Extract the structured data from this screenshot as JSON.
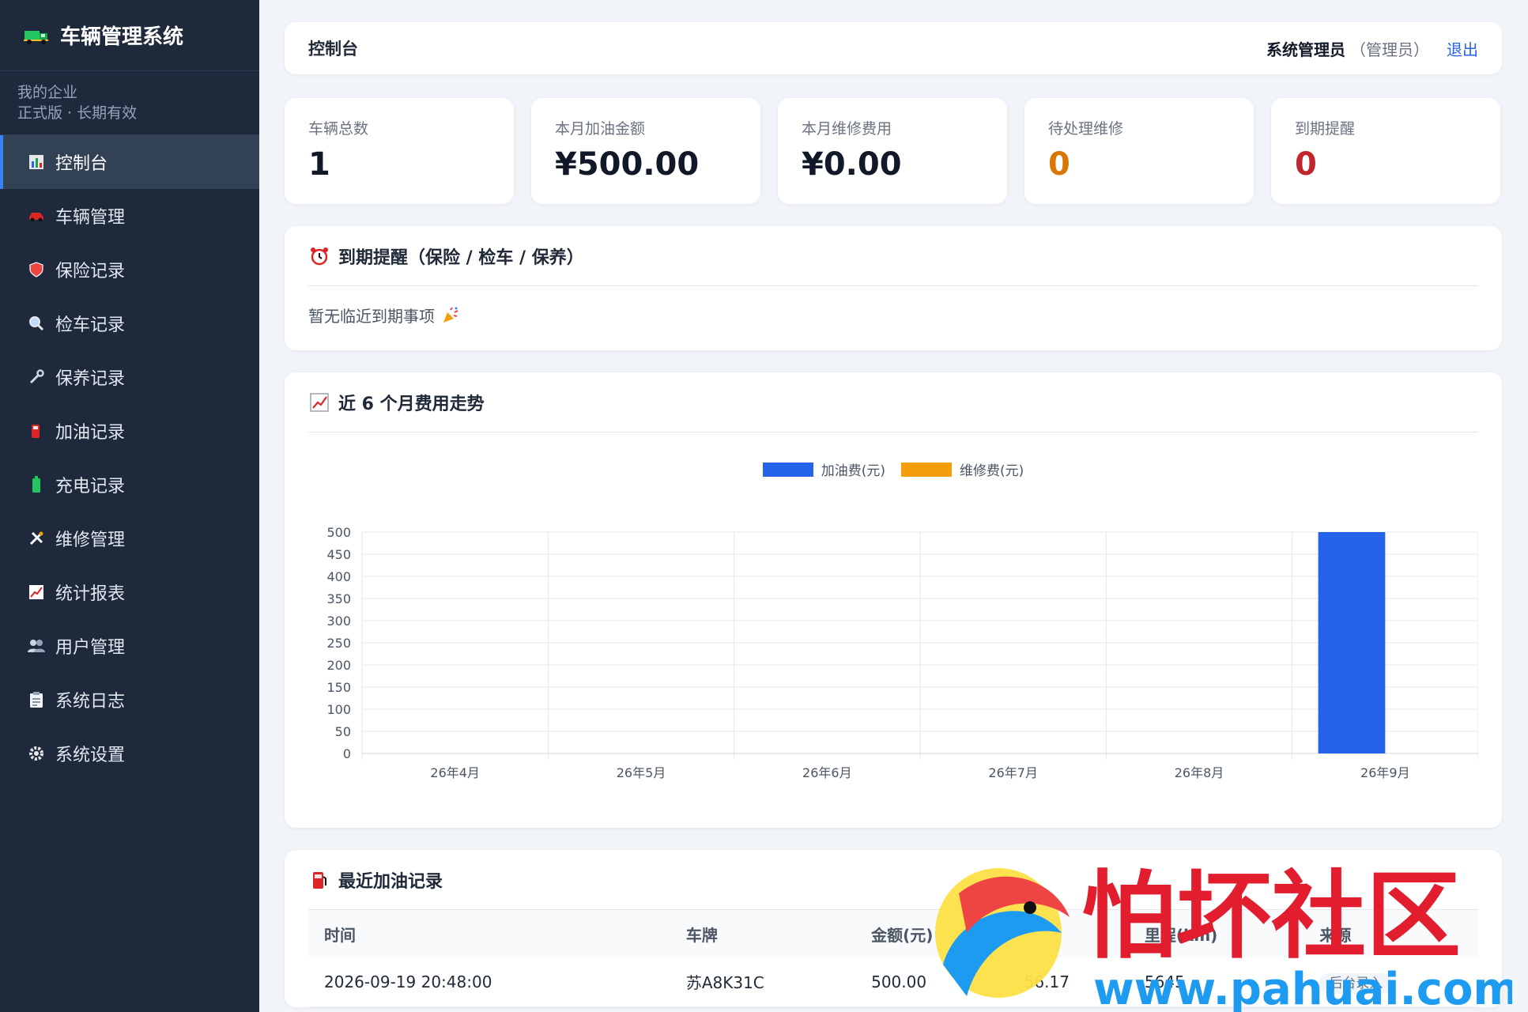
{
  "sidebar": {
    "brand": "车辆管理系统",
    "company_line1": "我的企业",
    "company_line2": "正式版 · 长期有效",
    "items": [
      {
        "label": "控制台",
        "icon": "bar-chart-icon",
        "active": true
      },
      {
        "label": "车辆管理",
        "icon": "car-icon"
      },
      {
        "label": "保险记录",
        "icon": "shield-icon"
      },
      {
        "label": "检车记录",
        "icon": "magnifier-icon"
      },
      {
        "label": "保养记录",
        "icon": "wrench-icon"
      },
      {
        "label": "加油记录",
        "icon": "fuel-pump-icon"
      },
      {
        "label": "充电记录",
        "icon": "battery-icon"
      },
      {
        "label": "维修管理",
        "icon": "tools-icon"
      },
      {
        "label": "统计报表",
        "icon": "trend-chart-icon"
      },
      {
        "label": "用户管理",
        "icon": "users-icon"
      },
      {
        "label": "系统日志",
        "icon": "clipboard-icon"
      },
      {
        "label": "系统设置",
        "icon": "gear-icon"
      }
    ]
  },
  "header": {
    "title": "控制台",
    "user_name": "系统管理员",
    "user_role": "（管理员）",
    "logout": "退出"
  },
  "stats": [
    {
      "label": "车辆总数",
      "value": "1",
      "color": "#111827"
    },
    {
      "label": "本月加油金额",
      "value": "¥500.00",
      "color": "#111827"
    },
    {
      "label": "本月维修费用",
      "value": "¥0.00",
      "color": "#111827"
    },
    {
      "label": "待处理维修",
      "value": "0",
      "color": "#d97706"
    },
    {
      "label": "到期提醒",
      "value": "0",
      "color": "#c0262d"
    }
  ],
  "reminders": {
    "title": "到期提醒（保险 / 检车 / 保养）",
    "empty_text": "暂无临近到期事项"
  },
  "trend": {
    "title": "近 6 个月费用走势"
  },
  "chart_data": {
    "type": "bar",
    "categories": [
      "26年4月",
      "26年5月",
      "26年6月",
      "26年7月",
      "26年8月",
      "26年9月"
    ],
    "series": [
      {
        "name": "加油费(元)",
        "values": [
          0,
          0,
          0,
          0,
          0,
          500
        ],
        "color": "#2563eb"
      },
      {
        "name": "维修费(元)",
        "values": [
          0,
          0,
          0,
          0,
          0,
          0
        ],
        "color": "#f59e0b"
      }
    ],
    "ylim": [
      0,
      500
    ],
    "yticks": [
      0,
      50,
      100,
      150,
      200,
      250,
      300,
      350,
      400,
      450,
      500
    ],
    "grid": true,
    "legend": "top-center"
  },
  "fuel": {
    "title": "最近加油记录",
    "columns": [
      "时间",
      "车牌",
      "金额(元)",
      "",
      "里程(km)",
      "来源"
    ],
    "rows": [
      {
        "time": "2026-09-19 20:48:00",
        "plate": "苏A8K31C",
        "amount": "500.00",
        "liters": "56.17",
        "mileage": "5645",
        "source": "后台录入"
      }
    ]
  },
  "watermark": {
    "text": "怕坏社区",
    "url": "www.pahuai.com"
  }
}
